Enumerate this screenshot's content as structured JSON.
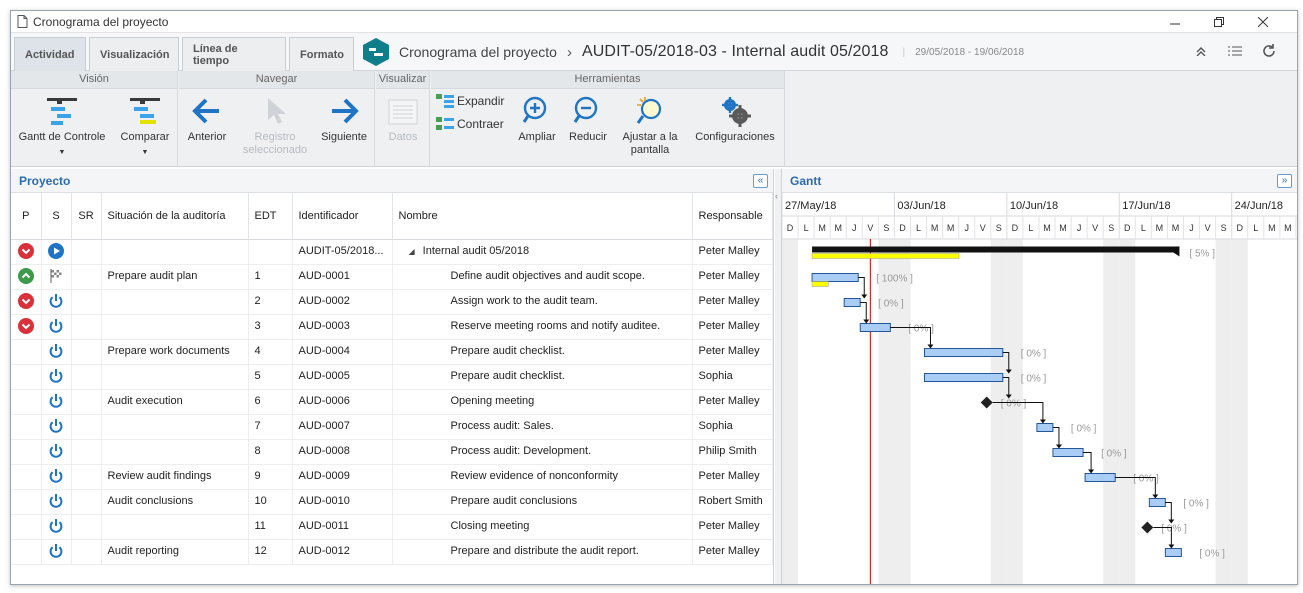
{
  "window": {
    "title": "Cronograma del proyecto",
    "doc_icon": "document-icon",
    "minimize_icon": "minimize-icon",
    "restore_icon": "restore-icon",
    "close_icon": "close-icon"
  },
  "tabs": [
    {
      "label": "Actividad",
      "active": true
    },
    {
      "label": "Visualización",
      "active": false
    },
    {
      "label": "Línea de tiempo",
      "active": false
    },
    {
      "label": "Formato",
      "active": false
    }
  ],
  "breadcrumb": {
    "module": "Cronograma del proyecto",
    "separator": "›",
    "record": "AUDIT-05/2018-03 - Internal audit 05/2018",
    "divider": "|",
    "dates": "29/05/2018 - 19/06/2018"
  },
  "ribbon": {
    "groups": {
      "vision": "Visión",
      "navegar": "Navegar",
      "visualizar": "Visualizar",
      "herramientas": "Herramientas"
    },
    "gantt_control": "Gantt de Controle",
    "compare": "Comparar",
    "previous": "Anterior",
    "selected_record": "Registro seleccionado",
    "next": "Siguiente",
    "data": "Datos",
    "expand": "Expandir",
    "collapse": "Contraer",
    "zoom_in": "Ampliar",
    "zoom_out": "Reducir",
    "fit": "Ajustar a la pantalla",
    "settings": "Configuraciones"
  },
  "project_panel": {
    "title": "Proyecto",
    "collapse": "«"
  },
  "gantt_panel": {
    "title": "Gantt",
    "expand": "»"
  },
  "columns": {
    "p": "P",
    "s": "S",
    "sr": "SR",
    "situation": "Situación de la auditoría",
    "edt": "EDT",
    "id": "Identificador",
    "name": "Nombre",
    "owner": "Responsable"
  },
  "rows": [
    {
      "p": "down",
      "s": "play",
      "situation": "",
      "edt": "",
      "id": "AUDIT-05/2018...",
      "name": "Internal audit 05/2018",
      "owner": "Peter Malley",
      "tree": "◢",
      "level": 0
    },
    {
      "p": "up",
      "s": "flag",
      "situation": "Prepare audit plan",
      "edt": "1",
      "id": "AUD-0001",
      "name": "Define audit objectives and audit scope.",
      "owner": "Peter Malley",
      "level": 1
    },
    {
      "p": "down",
      "s": "power",
      "situation": "",
      "edt": "2",
      "id": "AUD-0002",
      "name": "Assign work to the audit team.",
      "owner": "Peter Malley",
      "level": 1
    },
    {
      "p": "down",
      "s": "power",
      "situation": "",
      "edt": "3",
      "id": "AUD-0003",
      "name": "Reserve meeting rooms and notify auditee.",
      "owner": "Peter Malley",
      "level": 1
    },
    {
      "p": "",
      "s": "power",
      "situation": "Prepare work documents",
      "edt": "4",
      "id": "AUD-0004",
      "name": "Prepare audit checklist.",
      "owner": "Peter Malley",
      "level": 1
    },
    {
      "p": "",
      "s": "power",
      "situation": "",
      "edt": "5",
      "id": "AUD-0005",
      "name": "Prepare audit checklist.",
      "owner": "Sophia",
      "level": 1
    },
    {
      "p": "",
      "s": "power",
      "situation": "Audit execution",
      "edt": "6",
      "id": "AUD-0006",
      "name": "Opening meeting",
      "owner": "Peter Malley",
      "level": 1
    },
    {
      "p": "",
      "s": "power",
      "situation": "",
      "edt": "7",
      "id": "AUD-0007",
      "name": "Process audit: Sales.",
      "owner": "Sophia",
      "level": 1
    },
    {
      "p": "",
      "s": "power",
      "situation": "",
      "edt": "8",
      "id": "AUD-0008",
      "name": "Process audit: Development.",
      "owner": "Philip Smith",
      "level": 1
    },
    {
      "p": "",
      "s": "power",
      "situation": "Review audit findings",
      "edt": "9",
      "id": "AUD-0009",
      "name": "Review evidence of nonconformity",
      "owner": "Peter Malley",
      "level": 1
    },
    {
      "p": "",
      "s": "power",
      "situation": "Audit conclusions",
      "edt": "10",
      "id": "AUD-0010",
      "name": "Prepare audit conclusions",
      "owner": "Robert Smith",
      "level": 1
    },
    {
      "p": "",
      "s": "power",
      "situation": "",
      "edt": "11",
      "id": "AUD-0011",
      "name": "Closing meeting",
      "owner": "Peter Malley",
      "level": 1
    },
    {
      "p": "",
      "s": "power",
      "situation": "Audit reporting",
      "edt": "12",
      "id": "AUD-0012",
      "name": "Prepare and distribute the audit report.",
      "owner": "Peter Malley",
      "level": 1
    }
  ],
  "gantt": {
    "weeks": [
      "27/May/18",
      "03/Jun/18",
      "10/Jun/18",
      "17/Jun/18",
      "24/Jun/18"
    ],
    "day_letters": [
      "D",
      "L",
      "M",
      "M",
      "J",
      "V",
      "S"
    ],
    "today_day": 5,
    "tasks": [
      {
        "type": "summary",
        "start": 1,
        "end": 24,
        "progress": 5,
        "label": "[ 5% ]"
      },
      {
        "type": "task",
        "start": 1,
        "end": 4,
        "progress": 100,
        "label": "[ 100% ]"
      },
      {
        "type": "task",
        "start": 3,
        "end": 4,
        "progress": 0,
        "label": "[ 0% ]"
      },
      {
        "type": "task",
        "start": 4,
        "end": 6,
        "progress": 0,
        "label": "[ 0% ]"
      },
      {
        "type": "task",
        "start": 8,
        "end": 13,
        "progress": 0,
        "label": "[ 0% ]"
      },
      {
        "type": "task",
        "start": 8,
        "end": 13,
        "progress": 0,
        "label": "[ 0% ]"
      },
      {
        "type": "milestone",
        "start": 12,
        "end": 12,
        "progress": 0,
        "label": "[ 0% ]"
      },
      {
        "type": "task",
        "start": 15,
        "end": 16,
        "progress": 0,
        "label": "[ 0% ]"
      },
      {
        "type": "task",
        "start": 16,
        "end": 18,
        "progress": 0,
        "label": "[ 0% ]"
      },
      {
        "type": "task",
        "start": 18,
        "end": 20,
        "progress": 0,
        "label": "[ 0% ]"
      },
      {
        "type": "task",
        "start": 22,
        "end": 23,
        "progress": 0,
        "label": "[ 0% ]"
      },
      {
        "type": "milestone",
        "start": 22,
        "end": 22,
        "progress": 0,
        "label": "[ 0% ]"
      },
      {
        "type": "task",
        "start": 23,
        "end": 24,
        "progress": 0,
        "label": "[ 0% ]"
      }
    ]
  },
  "colors": {
    "accent": "#1f74c4",
    "green": "#3d9a4a",
    "red": "#d9313a",
    "bar_fill": "#a9cdf5",
    "bar_border": "#23569b",
    "progress": "#ffff00",
    "today": "#cc0000",
    "weekend": "#eeeeee"
  }
}
